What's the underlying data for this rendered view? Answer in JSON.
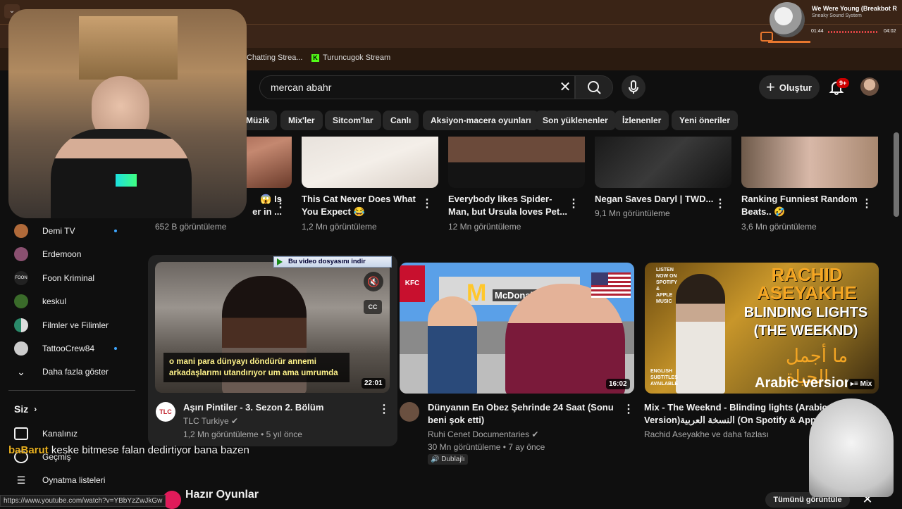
{
  "browser": {
    "bookmarks": [
      {
        "label": "Chatting Strea..."
      },
      {
        "label": "Turuncugok Stream",
        "icon": "kick-icon"
      }
    ],
    "status_url": "https://www.youtube.com/watch?v=YBbYzZwJkGw"
  },
  "media": {
    "title": "We Were Young (Breakbot R",
    "artist": "Sneaky Sound System",
    "elapsed": "01:44",
    "duration": "04:02"
  },
  "header": {
    "search_value": "mercan abahr",
    "create_label": "Oluştur",
    "notif_count": "9+"
  },
  "chips": [
    "Müzik",
    "Mix'ler",
    "Sitcom'lar",
    "Canlı",
    "Aksiyon-macera oyunları",
    "Son yüklenenler",
    "İzlenenler",
    "Yeni öneriler"
  ],
  "sidebar": {
    "subscriptions": [
      {
        "label": "Demi TV",
        "live": true
      },
      {
        "label": "Erdemoon",
        "live": false
      },
      {
        "label": "Foon Kriminal",
        "live": false
      },
      {
        "label": "keskul",
        "live": false
      },
      {
        "label": "Filmler ve Filimler",
        "live": false
      },
      {
        "label": "TattooCrew84",
        "live": true
      }
    ],
    "show_more": "Daha fazla göster",
    "you_section": "Siz",
    "you_items": [
      "Kanalınız",
      "Geçmiş",
      "Oynatma listeleri"
    ]
  },
  "row1": [
    {
      "title_l1": "😱 Is",
      "title_l2": "er in ...",
      "meta": "652 B görüntüleme"
    },
    {
      "title_l1": "This Cat Never Does What",
      "title_l2": "You Expect 😂",
      "meta": "1,2 Mn görüntüleme"
    },
    {
      "title_l1": "Everybody likes Spider-",
      "title_l2": "Man, but Ursula loves Pet...",
      "meta": "12 Mn görüntüleme"
    },
    {
      "title_l1": "Negan Saves Daryl | TWD...",
      "title_l2": "",
      "meta": "9,1 Mn görüntüleme"
    },
    {
      "title_l1": "Ranking Funniest Random",
      "title_l2": "Beats.. 🤣",
      "meta": "3,6 Mn görüntüleme"
    }
  ],
  "row2": [
    {
      "title": "Aşırı Pintiler - 3. Sezon 2. Bölüm",
      "channel": "TLC Turkiye",
      "meta": "1,2 Mn görüntüleme • 5 yıl önce",
      "duration": "22:01",
      "subtitle_l1": "o mani para dünyayı döndürür annemi",
      "subtitle_l2": "arkadaşlarımı utandırıyor um ama umrumda",
      "download_label": "Bu video dosyasını indir",
      "avatar_text": "TLC"
    },
    {
      "title_l1": "Dünyanın En Obez Şehrinde 24 Saat (Sonu",
      "title_l2": "beni şok etti)",
      "channel": "Ruhi Cenet Documentaries",
      "meta": "30 Mn görüntüleme • 7 ay önce",
      "badge": "Dublajlı",
      "duration": "16:02",
      "sign": "McDonald's",
      "kfc": "KFC"
    },
    {
      "title_l1": "Mix - The Weeknd - Blinding lights (Arabic",
      "title_l2": "Version)النسخة العربية (On Spotify & Apple Music)...",
      "channel": "Rachid Aseyakhe ve daha fazlası",
      "mix": "Mix",
      "thumb_l1": "RACHID",
      "thumb_l2": "ASEYAKHE",
      "thumb_l3": "BLINDING LIGHTS",
      "thumb_l4": "(THE WEEKND)",
      "thumb_arabic": "ما أجمل الحياة",
      "thumb_bottom": "Arabic versior",
      "thumb_listen": "LISTEN NOW ON SPOTIFY & APPLE MUSIC",
      "thumb_eng": "ENGLISH SUBTITLES AVAILABLE"
    }
  ],
  "section": {
    "title": "Hazır Oyunlar",
    "show_all": "Tümünü görüntüle"
  },
  "chat": {
    "user": "baBarut",
    "message": " keske bitmese falan dedirtiyor bana bazen"
  }
}
